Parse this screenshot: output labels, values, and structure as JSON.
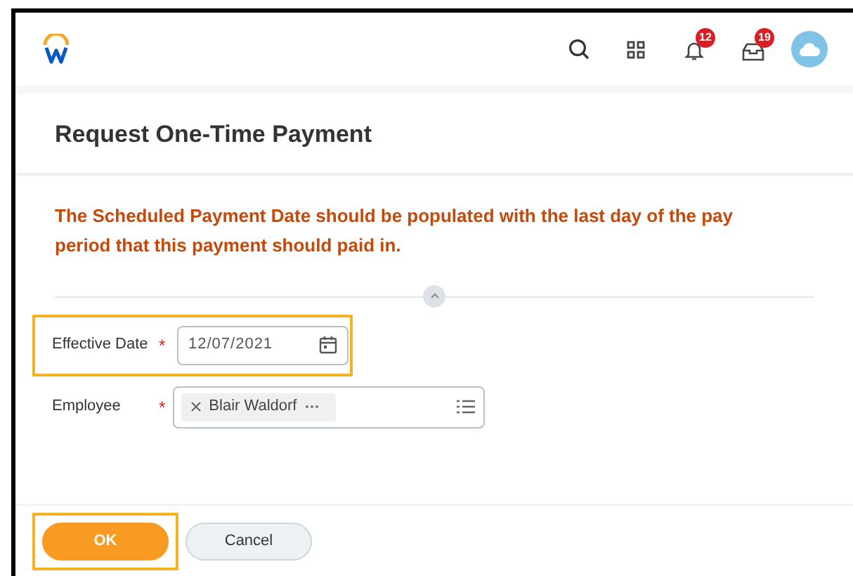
{
  "header": {
    "badges": [
      {
        "count": "12"
      },
      {
        "count": "19"
      }
    ]
  },
  "page": {
    "title": "Request One-Time Payment",
    "message": "The Scheduled Payment Date should be populated with the last day of the pay period that this payment should paid in."
  },
  "fields": [
    {
      "kind": "date",
      "label": "Effective Date",
      "required_marker": "*",
      "value": "12/07/2021",
      "highlighted": true
    },
    {
      "kind": "prompt",
      "label": "Employee",
      "required_marker": "*",
      "value": "Blair Waldorf",
      "highlighted": false
    }
  ],
  "buttons": [
    {
      "label": "OK",
      "kind": "primary",
      "highlighted": true
    },
    {
      "label": "Cancel",
      "kind": "secondary",
      "highlighted": false
    }
  ]
}
